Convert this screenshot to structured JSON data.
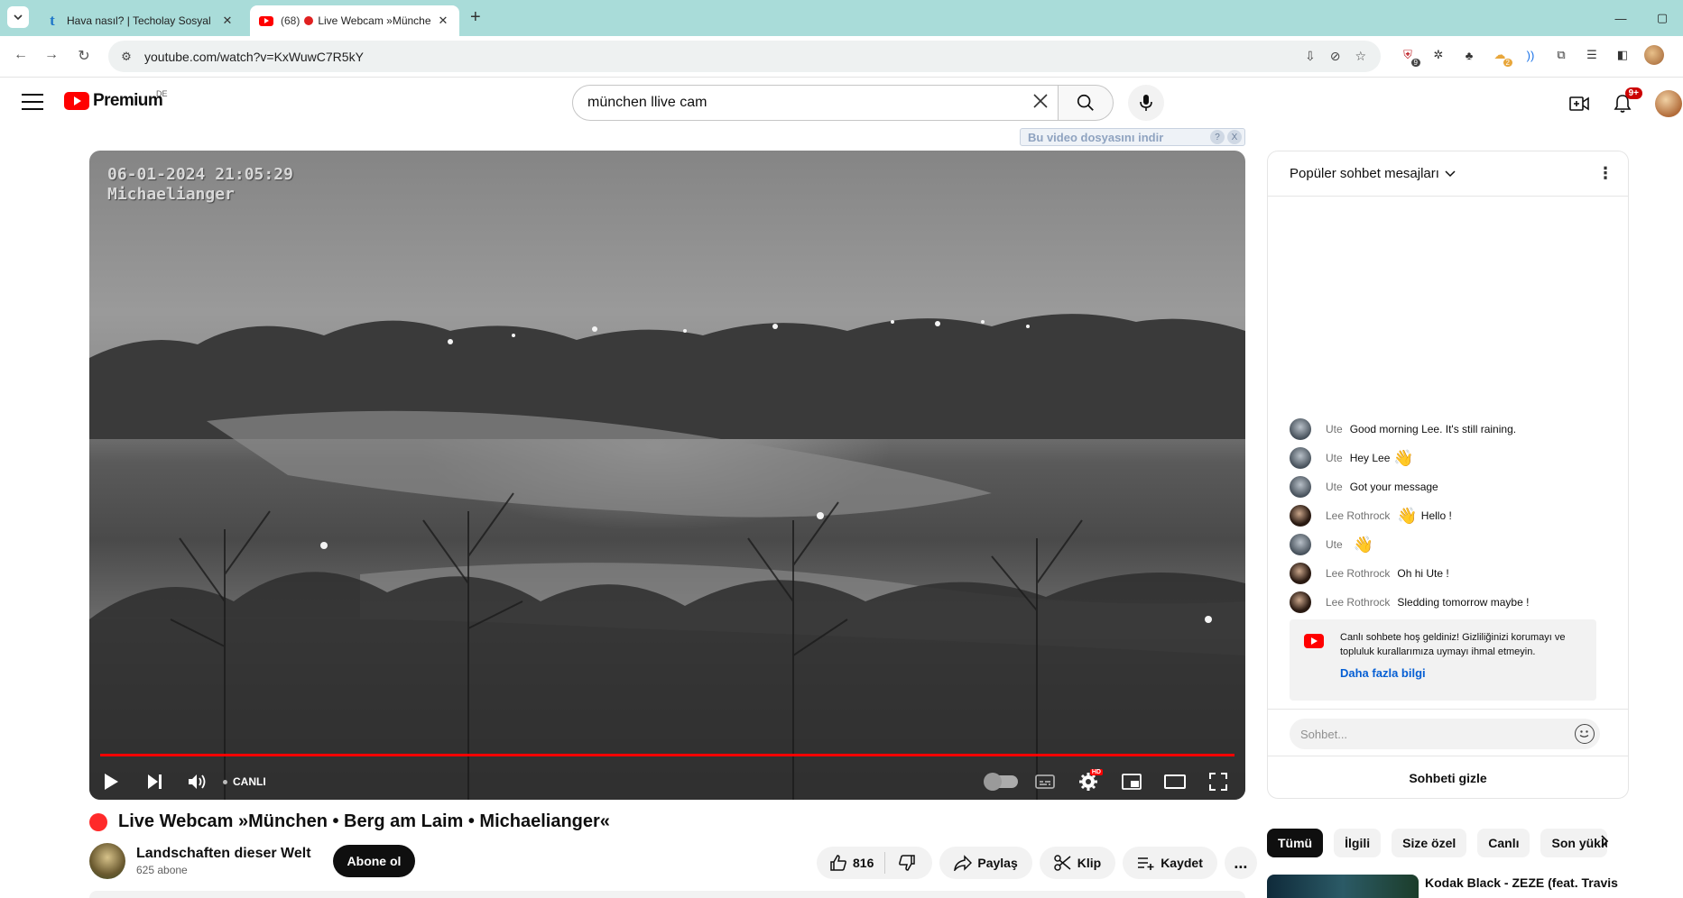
{
  "browser": {
    "tabs": [
      {
        "title": "Hava nasıl? | Techolay Sosyal",
        "active": false
      },
      {
        "count": "(68)",
        "title": "Live Webcam »Münche",
        "active": true
      }
    ],
    "address": "youtube.com/watch?v=KxWuwC7R5kY",
    "ext_badges": {
      "shield": "9",
      "cloud": "2"
    }
  },
  "header": {
    "logo": "Premium",
    "country": "DE",
    "search_query": "münchen llive cam",
    "notifications": "9+"
  },
  "downloader": {
    "label": "Bu video dosyasını indir",
    "help": "?",
    "close": "X"
  },
  "player": {
    "timestamp": "06-01-2024 21:05:29",
    "location": "Michaelianger",
    "live_label": "CANLI",
    "progress": 1.0,
    "hd_badge": "HD"
  },
  "video": {
    "title": "Live Webcam »München • Berg am Laim • Michaelianger«",
    "channel": "Landschaften dieser Welt",
    "subscribers": "625 abone",
    "subscribe_label": "Abone ol",
    "likes": "816",
    "share_label": "Paylaş",
    "clip_label": "Klip",
    "save_label": "Kaydet",
    "more_label": "..."
  },
  "chat": {
    "header": "Popüler sohbet mesajları",
    "messages": [
      {
        "author": "Ute",
        "text": "Good morning Lee. It's still raining.",
        "avatar": "ute"
      },
      {
        "author": "Ute",
        "text": "Hey Lee",
        "emoji": "👋",
        "avatar": "ute"
      },
      {
        "author": "Ute",
        "text": "Got your message",
        "avatar": "ute"
      },
      {
        "author": "Lee Rothrock",
        "emoji": "👋",
        "text": "Hello !",
        "avatar": "lee"
      },
      {
        "author": "Ute",
        "emoji": "👋",
        "text": "",
        "avatar": "ute"
      },
      {
        "author": "Lee Rothrock",
        "text": "Oh hi Ute !",
        "avatar": "lee"
      },
      {
        "author": "Lee Rothrock",
        "text": "Sledding tomorrow maybe !",
        "avatar": "lee"
      }
    ],
    "notice": "Canlı sohbete hoş geldiniz! Gizliliğinizi korumayı ve topluluk kurallarımıza uymayı ihmal etmeyin.",
    "notice_link": "Daha fazla bilgi",
    "input_placeholder": "Sohbet...",
    "hide_label": "Sohbeti gizle"
  },
  "chips": [
    "Tümü",
    "İlgili",
    "Size özel",
    "Canlı",
    "Son yükle"
  ],
  "related": {
    "title": "Kodak Black - ZEZE (feat. Travis"
  }
}
